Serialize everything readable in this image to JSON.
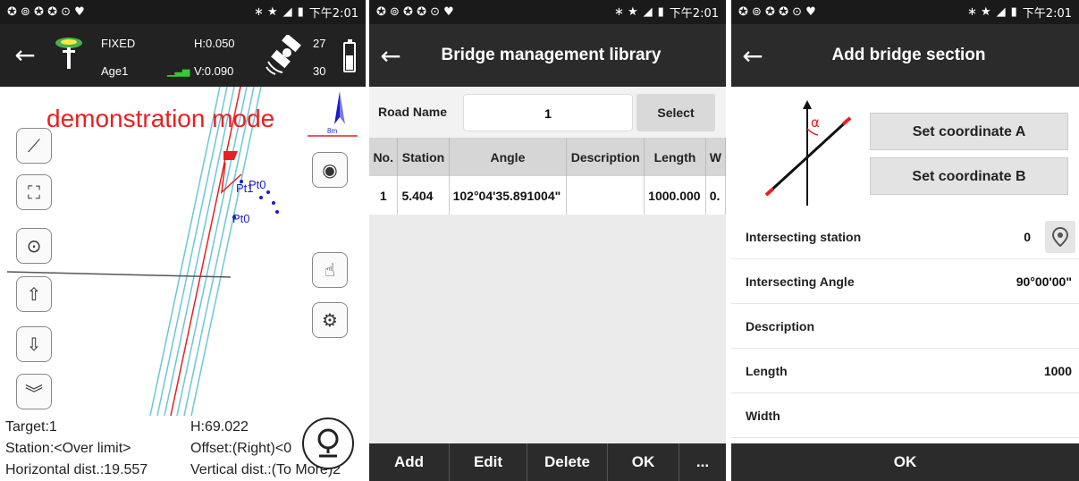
{
  "status": {
    "time": "下午2:01"
  },
  "survey": {
    "fix": "FIXED",
    "age": "Age1",
    "h": "H:0.050",
    "v": "V:0.090",
    "sat_top": "27",
    "sat_bottom": "30",
    "demo_text": "demonstration mode",
    "scale": "8m",
    "point_labels": [
      "Pt1",
      "Pt0",
      "Pt0"
    ],
    "info": {
      "target": "Target:1",
      "height": "H:69.022",
      "station": "Station:<Over limit>",
      "offset": "Offset:(Right)<0",
      "horizontal": "Horizontal dist.:19.557",
      "vertical": "Vertical dist.:(To More)2"
    },
    "icons": [
      "ruler-icon",
      "zoom-extent-icon",
      "locate-icon",
      "pan-up-icon",
      "pan-down-icon",
      "expand-icon",
      "layers-icon",
      "touch-icon",
      "settings-icon",
      "location-pin-icon"
    ]
  },
  "library": {
    "title": "Bridge management library",
    "road_label": "Road Name",
    "road_value": "1",
    "select_label": "Select",
    "columns": [
      "No.",
      "Station",
      "Angle",
      "Description",
      "Length",
      "W"
    ],
    "rows": [
      [
        "1",
        "5.404",
        "102°04'35.891004\"",
        "",
        "1000.000",
        "0."
      ]
    ],
    "actions": [
      "Add",
      "Edit",
      "Delete",
      "OK",
      "..."
    ]
  },
  "add_section": {
    "title": "Add bridge section",
    "alpha": "α",
    "set_a": "Set coordinate A",
    "set_b": "Set coordinate B",
    "fields": [
      {
        "label": "Intersecting station",
        "value": "0"
      },
      {
        "label": "Intersecting Angle",
        "value": "90°00'00\""
      },
      {
        "label": "Description",
        "value": ""
      },
      {
        "label": "Length",
        "value": "1000"
      },
      {
        "label": "Width",
        "value": ""
      }
    ],
    "ok": "OK"
  },
  "colors": {
    "dark_bar": "#2b2b2b",
    "demo_red": "#e82020",
    "point_blue": "#1a1acc",
    "line_cyan": "#6cc6d8"
  }
}
